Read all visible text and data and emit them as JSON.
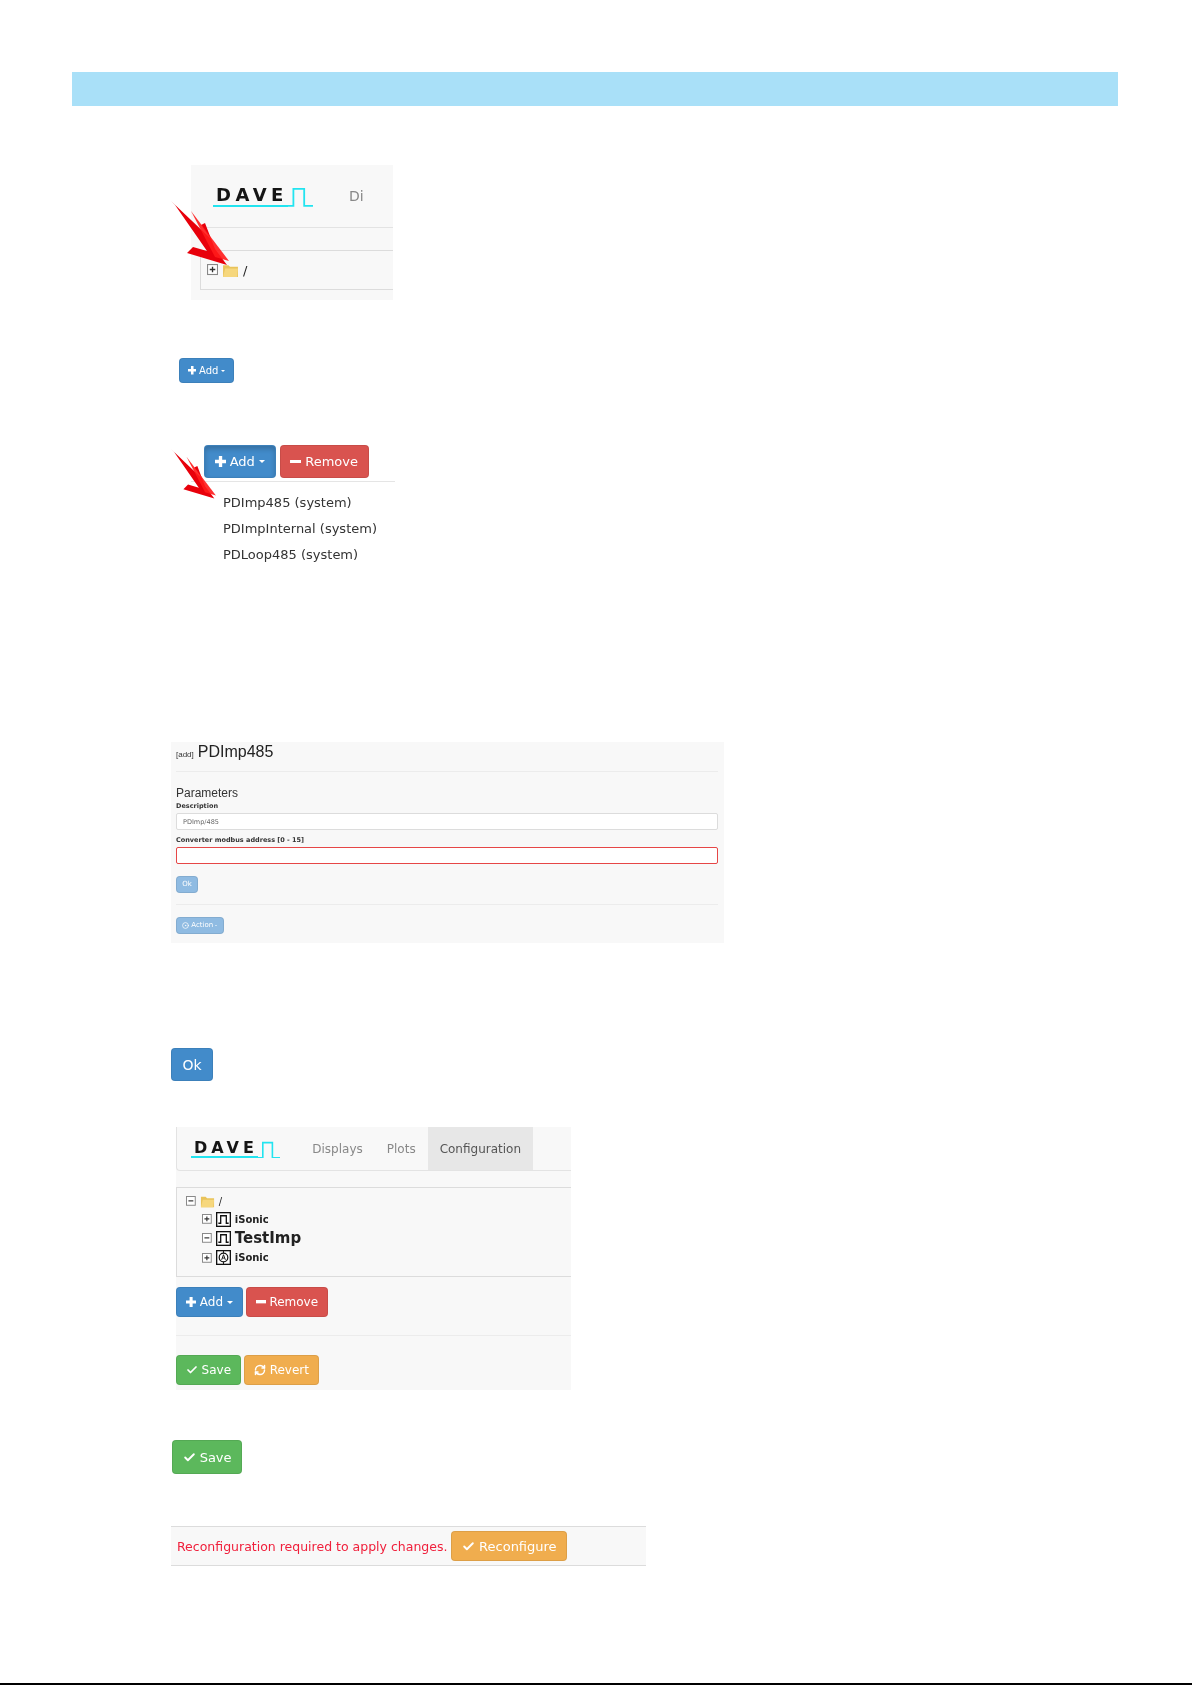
{
  "step1": {
    "brand": "DAVE",
    "nav_fragment": "Di",
    "tree": [
      {
        "label": "/",
        "kind": "folder",
        "expanded": false
      }
    ]
  },
  "step2": {
    "button": {
      "label": "Add",
      "kind": "add"
    }
  },
  "step3": {
    "buttons": [
      {
        "label": "Add",
        "kind": "add",
        "active": true
      },
      {
        "label": "Remove",
        "kind": "remove",
        "active": false
      }
    ],
    "menu": [
      "PDImp485 (system)",
      "PDImpInternal (system)",
      "PDLoop485 (system)"
    ]
  },
  "step4": {
    "tag": "[add]",
    "title": "PDImp485",
    "section": "Parameters",
    "fields": [
      {
        "label": "Description",
        "value": "PDImp/485",
        "invalid": false
      },
      {
        "label": "Converter modbus address [0 - 15]",
        "invalid": true
      }
    ],
    "submit": {
      "label": "Ok",
      "kind": "ok",
      "disabled": true
    },
    "action": {
      "label": "Action",
      "kind": "action",
      "disabled": true
    }
  },
  "step5": {
    "button": {
      "label": "Ok",
      "kind": "ok"
    }
  },
  "step6": {
    "brand": "DAVE",
    "tabs": [
      {
        "label": "Displays",
        "selected": false
      },
      {
        "label": "Plots",
        "selected": false
      },
      {
        "label": "Configuration",
        "selected": true
      }
    ],
    "tree": [
      {
        "label": "/",
        "kind": "folder",
        "expanded": true,
        "children": [
          {
            "label": "iSonic",
            "kind": "pulse",
            "expanded": false,
            "emphasized": false
          },
          {
            "label": "TestImp",
            "kind": "pulse",
            "expanded": true,
            "emphasized": true
          },
          {
            "label": "iSonic",
            "kind": "meter",
            "expanded": false,
            "emphasized": false
          }
        ]
      }
    ],
    "buttons": [
      {
        "label": "Add",
        "kind": "add"
      },
      {
        "label": "Remove",
        "kind": "remove"
      }
    ],
    "footer_buttons": [
      {
        "label": "Save",
        "kind": "save"
      },
      {
        "label": "Revert",
        "kind": "revert"
      }
    ]
  },
  "step7": {
    "button": {
      "label": "Save",
      "kind": "save"
    }
  },
  "step8": {
    "message": "Reconfiguration required to apply changes.",
    "button": {
      "label": "Reconfigure",
      "kind": "reconfigure"
    }
  }
}
